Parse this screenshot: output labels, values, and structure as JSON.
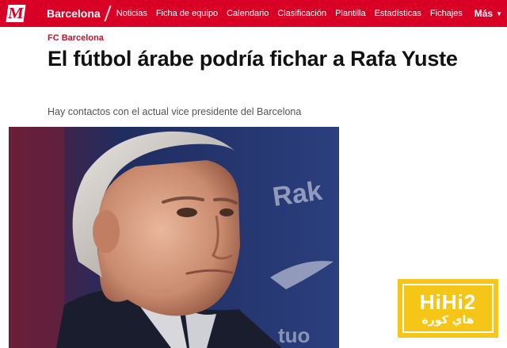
{
  "brand": {
    "logo_letter": "M",
    "accent": "#d80024"
  },
  "navbar": {
    "section": "Barcelona",
    "items": [
      "Noticias",
      "Ficha de equipo",
      "Calendario",
      "Clasificación",
      "Plantilla",
      "Estadísticas",
      "Fichajes"
    ],
    "more_label": "Más",
    "more_icon": "chevron-down-icon"
  },
  "article": {
    "kicker": "FC Barcelona",
    "headline": "El fútbol árabe podría fichar a Rafa Yuste",
    "subtitle": "Hay contactos con el actual vice presidente del Barcelona"
  },
  "watermark": {
    "title": "HiHi2",
    "arabic": "هاي كورة",
    "color": "#f5c518"
  }
}
